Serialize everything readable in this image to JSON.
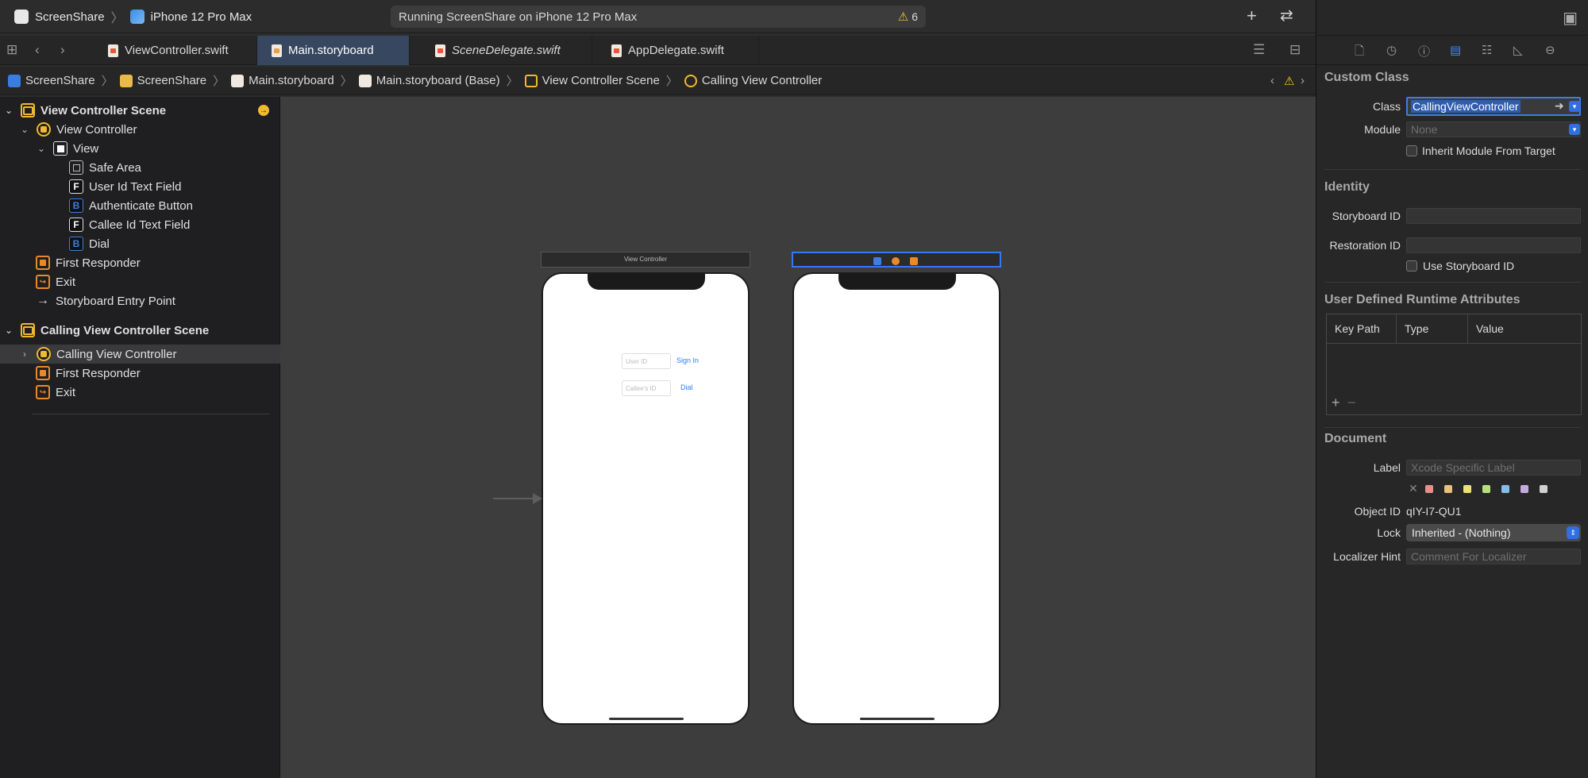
{
  "toolbar": {
    "scheme": "ScreenShare",
    "device": "iPhone 12 Pro Max",
    "activity": "Running ScreenShare on iPhone 12 Pro Max",
    "warning_count": "6"
  },
  "tabs": [
    {
      "label": "ViewController.swift"
    },
    {
      "label": "Main.storyboard"
    },
    {
      "label": "SceneDelegate.swift"
    },
    {
      "label": "AppDelegate.swift"
    }
  ],
  "breadcrumb": [
    "ScreenShare",
    "ScreenShare",
    "Main.storyboard",
    "Main.storyboard (Base)",
    "View Controller Scene",
    "Calling View Controller"
  ],
  "outline": {
    "scene1": "View Controller Scene",
    "vc": "View Controller",
    "view": "View",
    "safe_area": "Safe Area",
    "user_field": "User Id Text Field",
    "auth_btn": "Authenticate Button",
    "callee_field": "Callee Id Text Field",
    "dial": "Dial",
    "first_responder": "First Responder",
    "exit": "Exit",
    "entry": "Storyboard Entry Point",
    "scene2": "Calling View Controller Scene",
    "cvc": "Calling View Controller",
    "first_responder2": "First Responder",
    "exit2": "Exit"
  },
  "canvas": {
    "scene1_title": "View Controller",
    "user_placeholder": "User ID",
    "sign_in": "Sign In",
    "callee_placeholder": "Callee's ID",
    "dial": "Dial"
  },
  "inspector": {
    "custom_class": "Custom Class",
    "class_label": "Class",
    "class_value": "CallingViewController",
    "module_label": "Module",
    "module_value": "None",
    "inherit": "Inherit Module From Target",
    "identity": "Identity",
    "storyboard_id": "Storyboard ID",
    "restoration_id": "Restoration ID",
    "use_storyboard_id": "Use Storyboard ID",
    "udra": "User Defined Runtime Attributes",
    "col_keypath": "Key Path",
    "col_type": "Type",
    "col_value": "Value",
    "document": "Document",
    "label_label": "Label",
    "label_placeholder": "Xcode Specific Label",
    "object_id_label": "Object ID",
    "object_id": "qIY-I7-QU1",
    "lock_label": "Lock",
    "lock_value": "Inherited - (Nothing)",
    "localizer_label": "Localizer Hint",
    "localizer_placeholder": "Comment For Localizer"
  },
  "colors": {
    "accent": "#3d7ee0",
    "scene_icon": "#f1b92d",
    "responder_icon": "#e8892a"
  }
}
